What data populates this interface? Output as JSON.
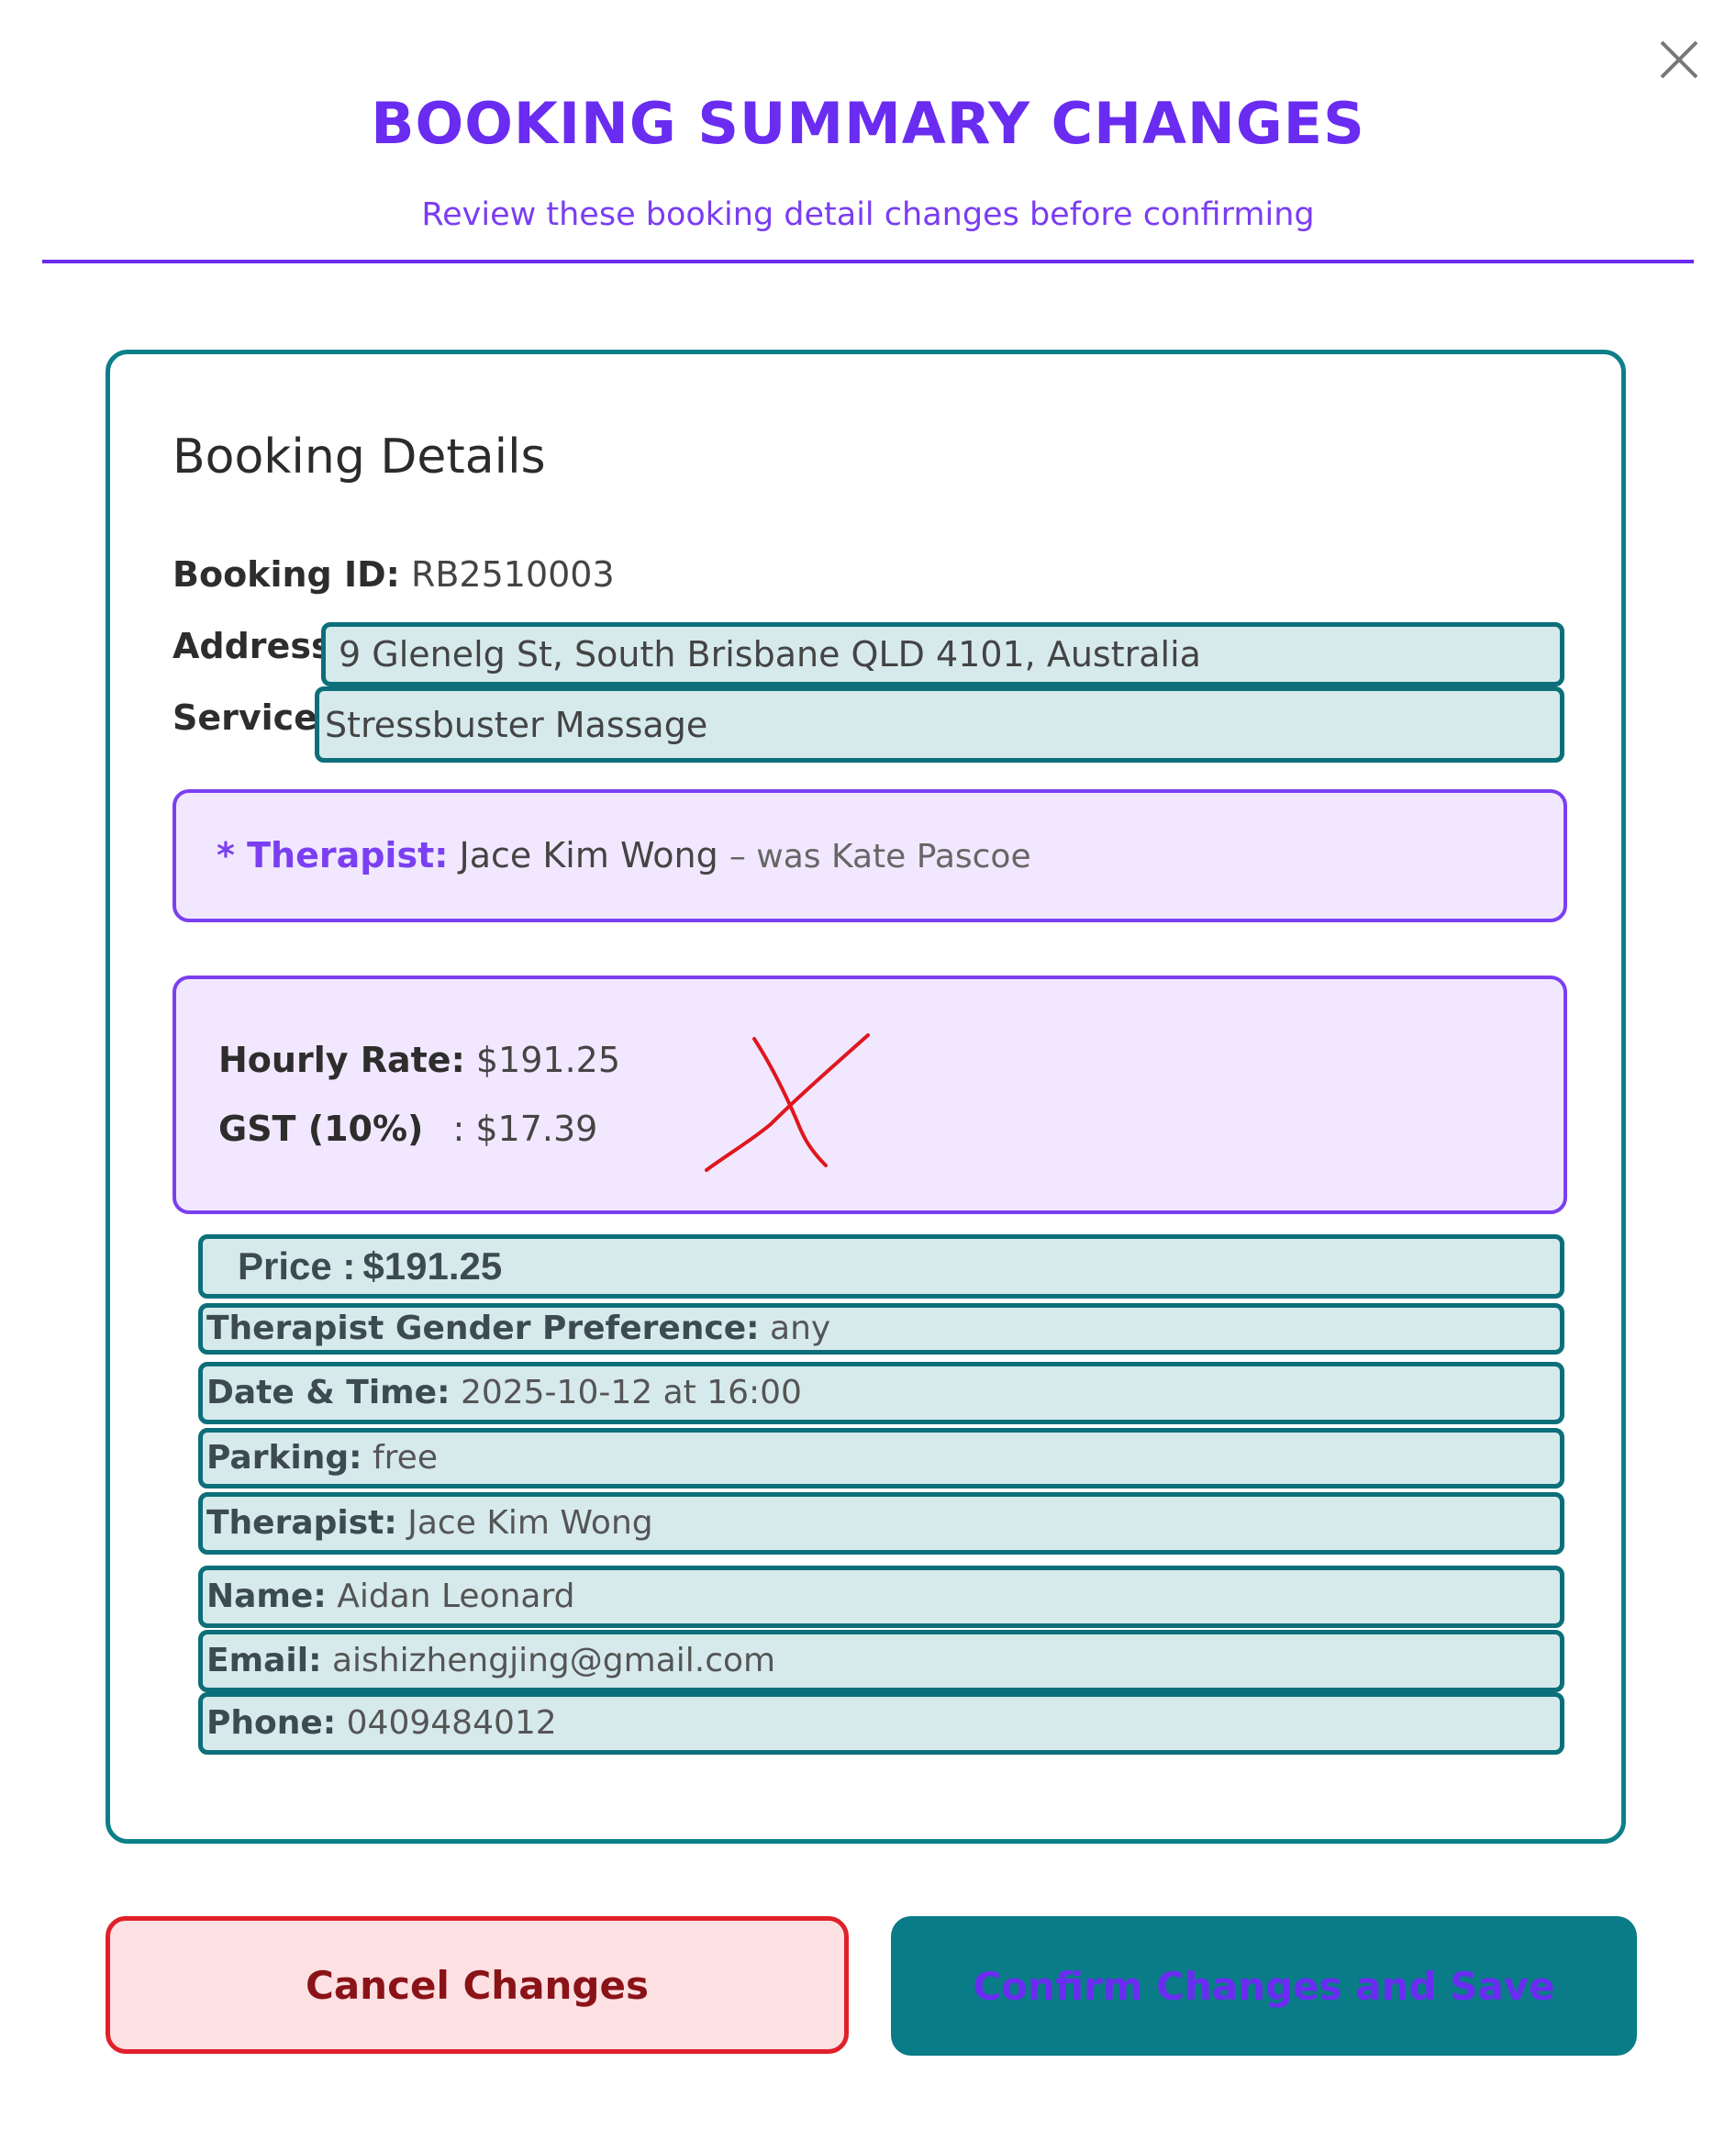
{
  "dialog": {
    "title": "BOOKING SUMMARY CHANGES",
    "subtitle": "Review these booking detail changes before confirming",
    "close_icon": "close-icon"
  },
  "details": {
    "heading": "Booking Details",
    "booking_id_label": "Booking ID:",
    "booking_id": "RB2510003",
    "address_label": "Address:",
    "address": "9 Glenelg St, South Brisbane QLD 4101, Australia",
    "service_label": "Service:",
    "service": "Stressbuster Massage"
  },
  "therapist_change": {
    "label": "* Therapist:",
    "new_value": "Jace Kim Wong",
    "previous": "– was Kate Pascoe"
  },
  "pricing": {
    "hourly_rate_label": "Hourly Rate:",
    "hourly_rate": "$191.25",
    "gst_label": "GST (10%)",
    "gst_value": ": $17.39",
    "price_label": "Price :",
    "price": "$191.25",
    "annotation_mark_color": "#e0161f"
  },
  "summary_rows": [
    {
      "label": "Therapist Gender Preference:",
      "value": "any"
    },
    {
      "label": "Date & Time:",
      "value": "2025-10-12 at 16:00"
    },
    {
      "label": "Parking:",
      "value": "free"
    },
    {
      "label": "Therapist:",
      "value": "Jace Kim Wong"
    },
    {
      "label": "Name:",
      "value": "Aidan Leonard"
    },
    {
      "label": "Email:",
      "value": "aishizhengjing@gmail.com"
    },
    {
      "label": "Phone:",
      "value": "0409484012"
    }
  ],
  "buttons": {
    "cancel": "Cancel Changes",
    "confirm": "Confirm Changes and Save"
  },
  "colors": {
    "accent_purple": "#6a2cf0",
    "teal": "#0c7f88",
    "highlight_fill": "#d6eaec",
    "cancel_red": "#e0202a"
  }
}
